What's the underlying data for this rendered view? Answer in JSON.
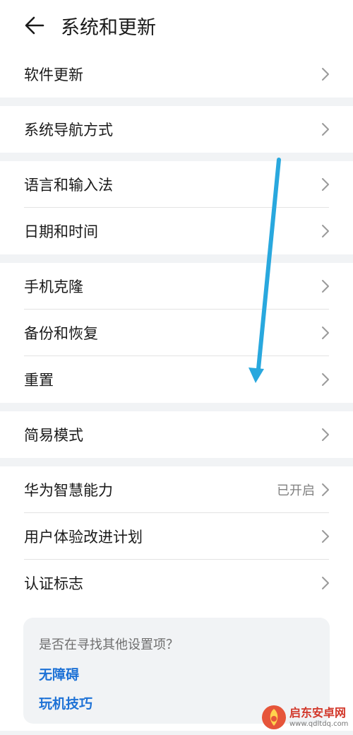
{
  "header": {
    "title": "系统和更新",
    "back_icon": "arrow-left-icon"
  },
  "groups": [
    {
      "items": [
        {
          "label": "软件更新"
        }
      ]
    },
    {
      "items": [
        {
          "label": "系统导航方式"
        }
      ]
    },
    {
      "items": [
        {
          "label": "语言和输入法"
        },
        {
          "label": "日期和时间"
        }
      ]
    },
    {
      "items": [
        {
          "label": "手机克隆"
        },
        {
          "label": "备份和恢复"
        },
        {
          "label": "重置"
        }
      ]
    },
    {
      "items": [
        {
          "label": "简易模式"
        }
      ]
    },
    {
      "items": [
        {
          "label": "华为智慧能力",
          "value": "已开启"
        },
        {
          "label": "用户体验改进计划"
        },
        {
          "label": "认证标志"
        }
      ]
    }
  ],
  "suggestions": {
    "title": "是否在寻找其他设置项？",
    "links": [
      "无障碍",
      "玩机技巧"
    ]
  },
  "watermark": {
    "name": "启东安卓网",
    "url": "www.qdltdq.com"
  },
  "colors": {
    "link": "#1e72d6",
    "annotation_arrow": "#29a8de",
    "background": "#f1f3f5"
  }
}
